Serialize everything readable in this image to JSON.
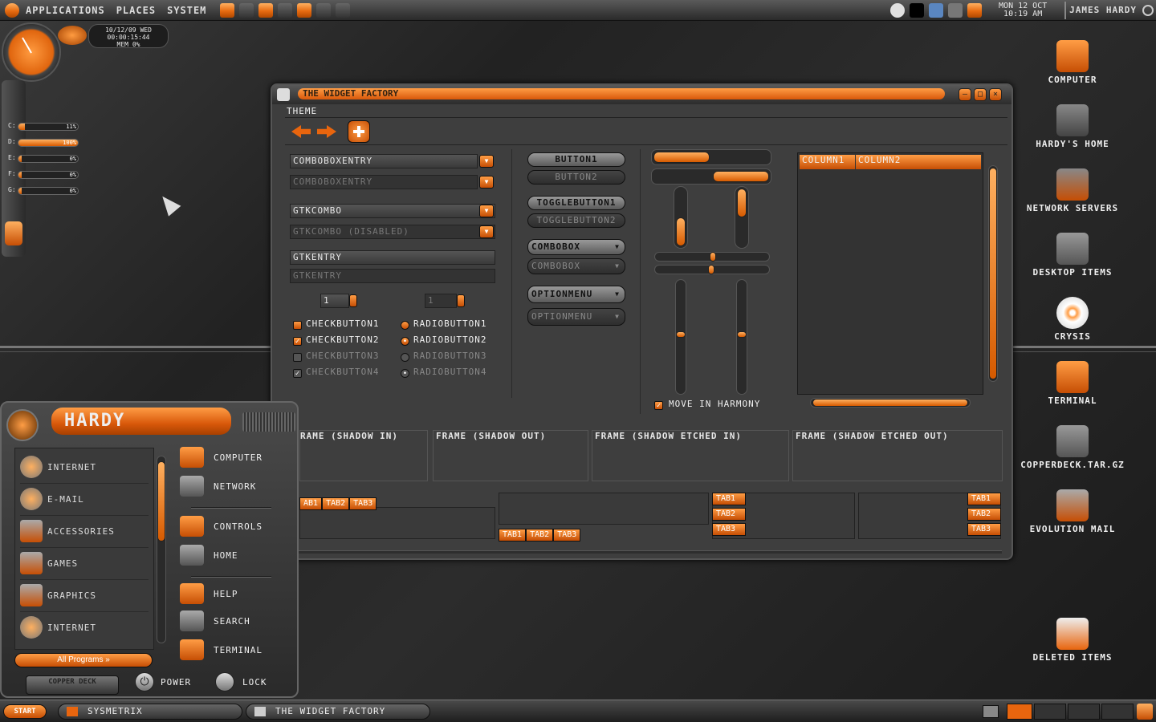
{
  "top_panel": {
    "menus": [
      "Applications",
      "Places",
      "System"
    ],
    "clock": "Mon 12 Oct\n10:19 AM",
    "clock_line1": "Mon 12 Oct",
    "clock_line2": "10:19 AM",
    "user": "James Hardy"
  },
  "desklet": {
    "date": "10/12/09 Wed",
    "uptime": "00:00:15:44",
    "mem": "Mem 0%",
    "drives": [
      {
        "letter": "C:",
        "pct": "11%",
        "fill": 0.11
      },
      {
        "letter": "D:",
        "pct": "100%",
        "fill": 1.0
      },
      {
        "letter": "E:",
        "pct": "0%",
        "fill": 0.0
      },
      {
        "letter": "F:",
        "pct": "0%",
        "fill": 0.0
      },
      {
        "letter": "G:",
        "pct": "0%",
        "fill": 0.0
      }
    ]
  },
  "desktop_icons": [
    "Computer",
    "Hardy's Home",
    "Network Servers",
    "Desktop Items",
    "Crysis",
    "Terminal",
    "CopperDeck.tar.gz",
    "Evolution Mail",
    "Deleted Items"
  ],
  "window": {
    "title": "The Widget Factory",
    "menu": "Theme",
    "combos": [
      "ComboBoxEntry",
      "ComboBoxEntry",
      "GtkCombo",
      "GtkCombo (disabled)"
    ],
    "entries": [
      "GtkEntry",
      "GtkEntry"
    ],
    "spin1": "1",
    "spin2": "1",
    "checks": [
      "CheckButton1",
      "CheckButton2",
      "CheckButton3",
      "CheckButton4"
    ],
    "radios": [
      "RadioButton1",
      "RadioButton2",
      "RadioButton3",
      "RadioButton4"
    ],
    "buttons": [
      "Button1",
      "Button2",
      "ToggleButton1",
      "ToggleButton2",
      "ComboBox",
      "ComboBox",
      "OptionMenu",
      "OptionMenu"
    ],
    "move_harmony": "Move in harmony",
    "columns": [
      "Column1",
      "Column2"
    ],
    "frames": [
      "rame (shadow in)",
      "Frame (shadow out)",
      "Frame (shadow etched in)",
      "Frame (shadow etched out)"
    ],
    "tabs": [
      "Tab1",
      "Tab2",
      "Tab3"
    ],
    "tab_cut": "ab1"
  },
  "start_menu": {
    "user": "Hardy",
    "left_items": [
      "Internet",
      "E-mail",
      "Accessories",
      "Games",
      "Graphics",
      "Internet"
    ],
    "all_programs": "All Programs",
    "right_items": [
      "Computer",
      "Network",
      "Controls",
      "Home",
      "Help",
      "Search",
      "Terminal"
    ],
    "brand": "Copper Deck",
    "power": "Power",
    "lock": "Lock"
  },
  "bottom_panel": {
    "start": "Start",
    "tasks": [
      "Sysmetrix",
      "The Widget Factory"
    ]
  },
  "colors": {
    "accent": "#e8650e",
    "bg": "#2a2a2a"
  }
}
